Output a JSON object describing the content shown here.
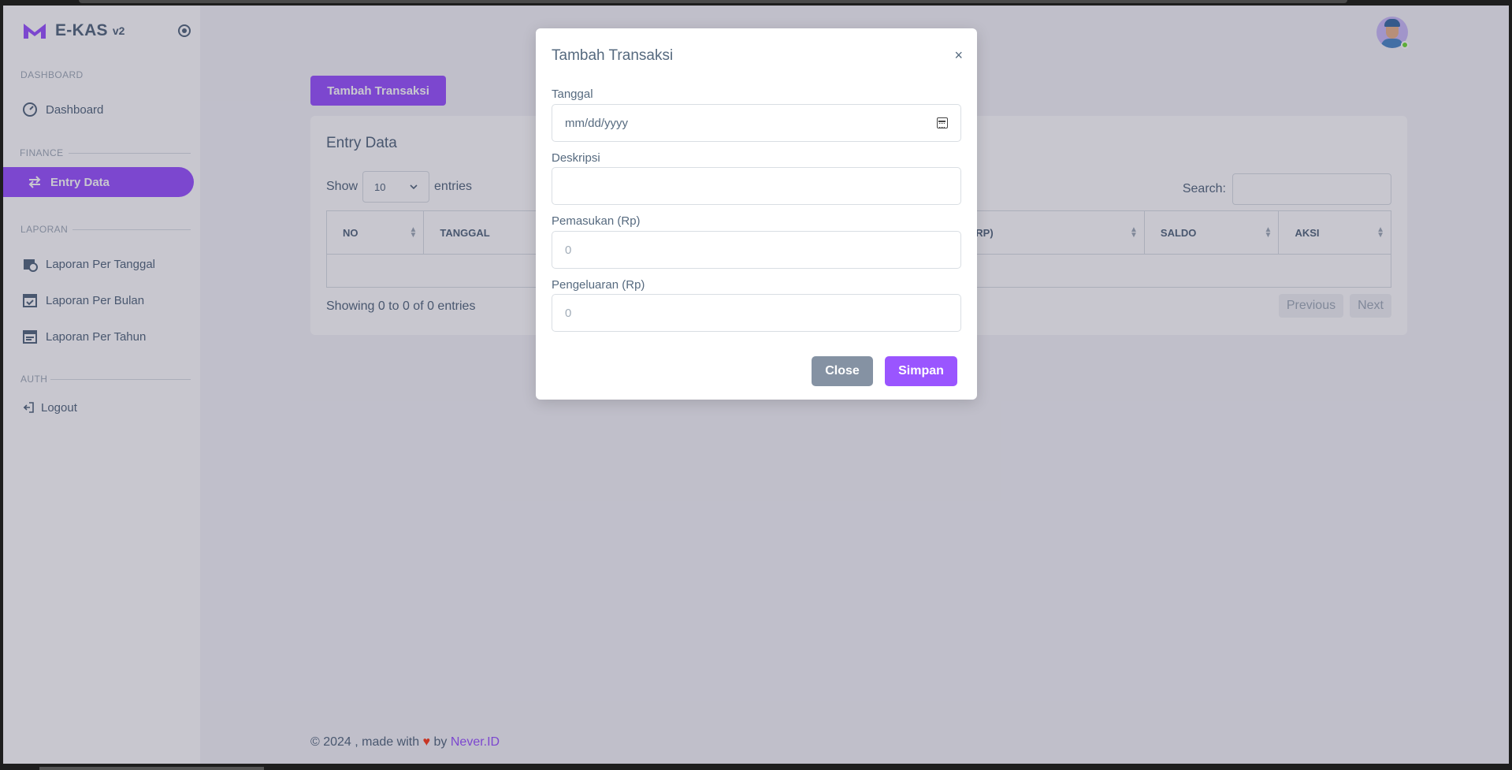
{
  "app": {
    "name": "E-KAS",
    "version": "v2"
  },
  "sidebar": {
    "sections": [
      {
        "label": "DASHBOARD"
      },
      {
        "label": "FINANCE"
      },
      {
        "label": "LAPORAN"
      },
      {
        "label": "AUTH"
      }
    ],
    "items": [
      {
        "label": "Dashboard",
        "icon": "gauge-icon"
      },
      {
        "label": "Entry Data",
        "icon": "swap-arrows-icon",
        "active": true
      },
      {
        "label": "Laporan Per Tanggal",
        "icon": "calendar-clock-icon"
      },
      {
        "label": "Laporan Per Bulan",
        "icon": "calendar-check-icon"
      },
      {
        "label": "Laporan Per Tahun",
        "icon": "calendar-list-icon"
      },
      {
        "label": "Logout",
        "icon": "logout-icon"
      }
    ]
  },
  "main": {
    "add_button": "Tambah Transaksi",
    "card_title": "Entry Data",
    "show_label": "Show",
    "entries_label": "entries",
    "page_size": "10",
    "search_label": "Search:",
    "columns": [
      "NO",
      "TANGGAL",
      "ELUARAN (RP)",
      "SALDO",
      "AKSI"
    ],
    "info": "Showing 0 to 0 of 0 entries",
    "prev": "Previous",
    "next": "Next"
  },
  "footer": {
    "prefix": "© 2024 , made with",
    "by": "by",
    "link": "Never.ID"
  },
  "modal": {
    "title": "Tambah Transaksi",
    "close_symbol": "×",
    "fields": [
      {
        "label": "Tanggal",
        "placeholder": "mm/dd/yyyy"
      },
      {
        "label": "Deskripsi",
        "placeholder": ""
      },
      {
        "label": "Pemasukan (Rp)",
        "placeholder": "0"
      },
      {
        "label": "Pengeluaran (Rp)",
        "placeholder": "0"
      }
    ],
    "close_button": "Close",
    "save_button": "Simpan"
  },
  "colors": {
    "accent": "#9a55ff",
    "secondary": "#8592a3",
    "online": "#71dd37"
  }
}
